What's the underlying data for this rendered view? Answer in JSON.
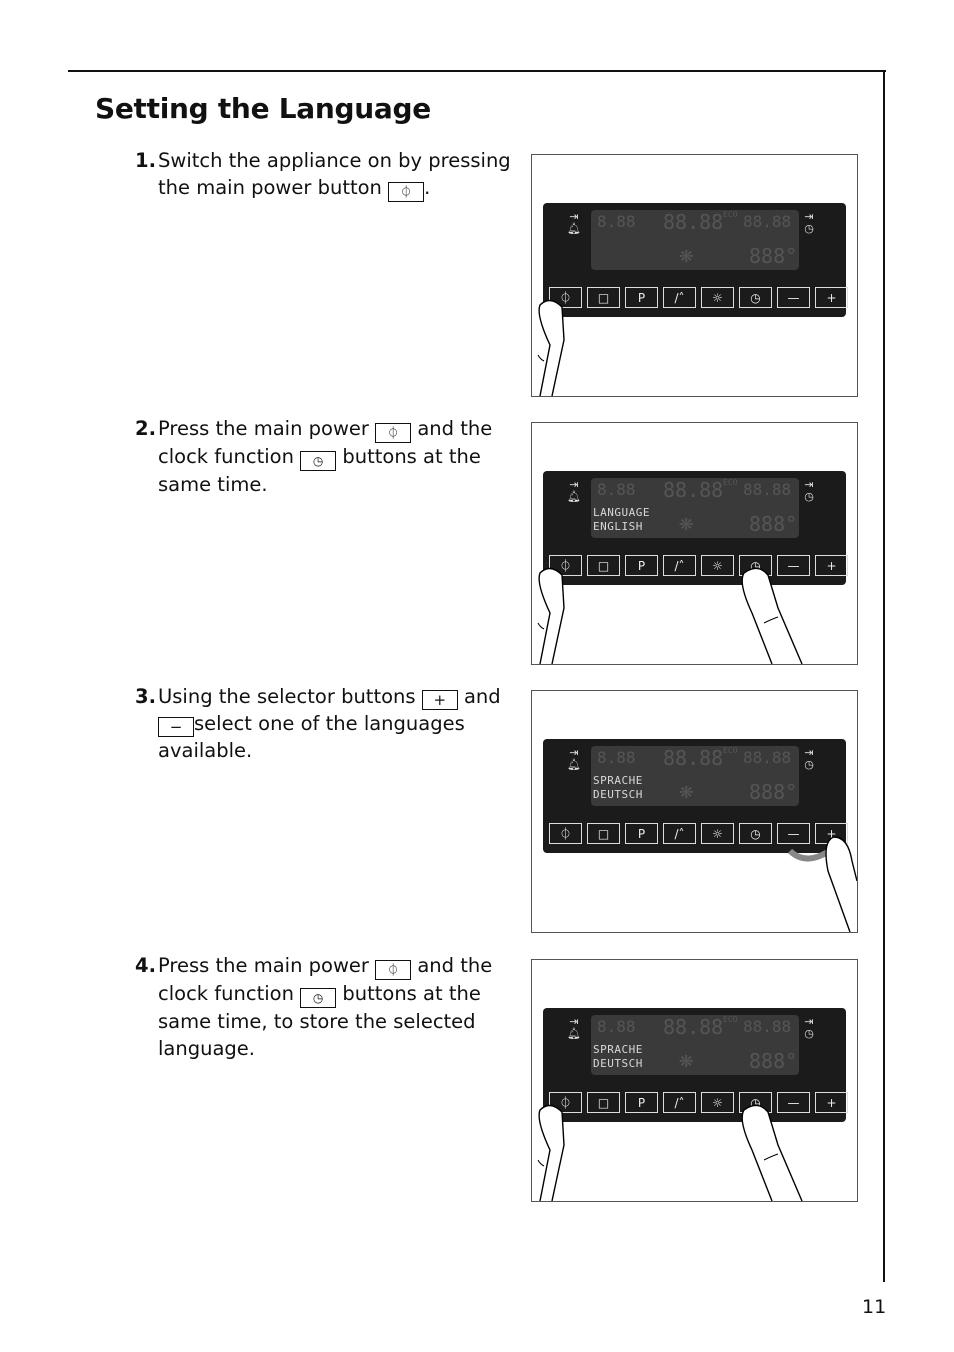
{
  "page": {
    "title": "Setting the Language",
    "page_number": "11"
  },
  "steps": [
    {
      "number": "1.",
      "parts": [
        "Switch the appliance on by pressing the main power button",
        "."
      ],
      "icons": [
        "power-icon"
      ]
    },
    {
      "number": "2.",
      "parts": [
        "Press the main power",
        "and the clock function",
        "buttons at the same time."
      ],
      "icons": [
        "power-icon",
        "clock-icon"
      ]
    },
    {
      "number": "3.",
      "parts": [
        "Using the selector buttons",
        "and",
        "select one of the languages available."
      ],
      "icons": [
        "plus-icon",
        "minus-icon"
      ]
    },
    {
      "number": "4.",
      "parts": [
        "Press the main power",
        "and the clock function",
        "buttons at the same time, to store the selected language."
      ],
      "icons": [
        "power-icon",
        "clock-icon"
      ]
    }
  ],
  "icon_glyphs": {
    "power": "⏀",
    "clock": "◷",
    "plus": "+",
    "minus": "−",
    "stop": "□",
    "program": "P",
    "meat_probe": "⁄",
    "light": "☼"
  },
  "panel": {
    "buttons": [
      "⏀",
      "□",
      "P",
      "/˄",
      "☼",
      "◷",
      "—",
      "+"
    ],
    "button_names": [
      "power",
      "stop",
      "program",
      "meat-probe",
      "light",
      "clock",
      "minus",
      "plus"
    ],
    "lcd_segments": {
      "time1": "8.88",
      "time2": "88.88",
      "time3": "88.88",
      "eco": "ECO",
      "temp": "888°"
    },
    "figures": [
      {
        "line1": "",
        "line2": ""
      },
      {
        "line1": "LANGUAGE",
        "line2": "ENGLISH"
      },
      {
        "line1": "SPRACHE",
        "line2": "DEUTSCH"
      },
      {
        "line1": "SPRACHE",
        "line2": "DEUTSCH"
      }
    ]
  }
}
